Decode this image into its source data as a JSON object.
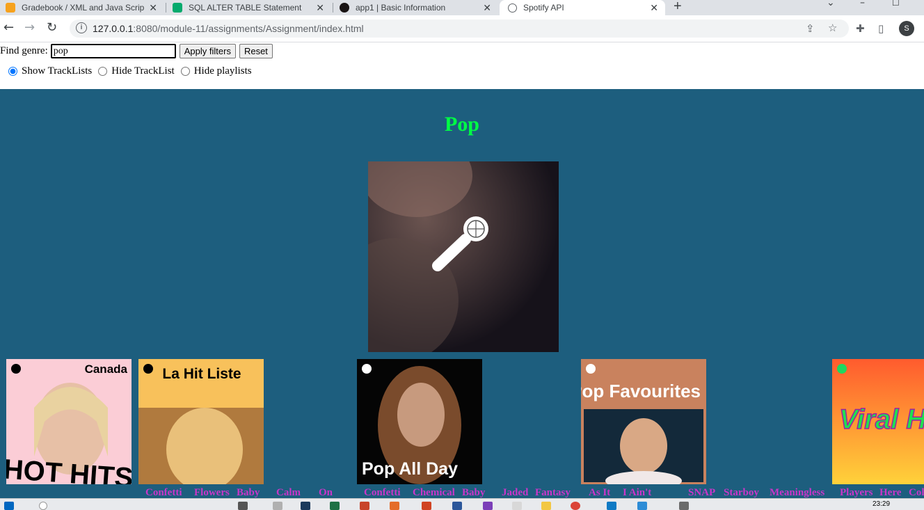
{
  "browser": {
    "tabs": [
      {
        "title": "Gradebook / XML and Java Scripting",
        "active": false
      },
      {
        "title": "SQL ALTER TABLE Statement",
        "active": false
      },
      {
        "title": "app1 | Basic Information",
        "active": false
      },
      {
        "title": "Spotify API",
        "active": true
      }
    ],
    "url_host": "127.0.0.1",
    "url_rest": ":8080/module-11/assignments/Assignment/index.html",
    "profile_initial": "S"
  },
  "filters": {
    "find_label": "Find genre:",
    "genre_value": "pop",
    "apply_label": "Apply filters",
    "reset_label": "Reset"
  },
  "view_options": [
    {
      "label": "Show TrackLists",
      "checked": true
    },
    {
      "label": "Hide TrackList",
      "checked": false
    },
    {
      "label": "Hide playlists",
      "checked": false
    }
  ],
  "genre": {
    "title": "Pop",
    "image_icon": "microphone-icon"
  },
  "playlists": [
    {
      "cover_text": "Canada",
      "cover_subtext": "HOT HITS"
    },
    {
      "cover_text": "La Hit Liste"
    },
    {
      "cover_text": "Pop All Day"
    },
    {
      "cover_text": "Pop Favourites"
    },
    {
      "cover_text": "Viral Hits"
    }
  ],
  "tracks": [
    "Confetti",
    "Flowers",
    "Baby",
    "Calm",
    "On",
    "Confetti",
    "Chemical",
    "Baby",
    "Jaded",
    "Fantasy",
    "As It",
    "I Ain't",
    "SNAP",
    "Starboy",
    "Meaningless",
    "Players",
    "Here",
    "Col"
  ],
  "taskbar": {
    "time": "23:29"
  },
  "colors": {
    "panel_bg": "#1d5e7e",
    "genre_title": "#00ff44",
    "track_text": "#c936c9"
  }
}
